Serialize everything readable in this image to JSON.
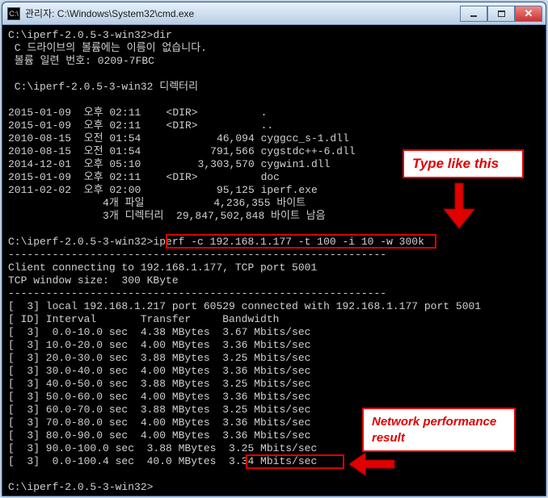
{
  "window": {
    "title": "관리자: C:\\Windows\\System32\\cmd.exe",
    "icon_glyph": "C:\\"
  },
  "terminal": {
    "prompt1": "C:\\iperf-2.0.5-3-win32>",
    "cmd_dir": "dir",
    "vol_line": " C 드라이브의 볼륨에는 이름이 없습니다.",
    "serial_line": " 볼륨 일련 번호: 0209-7FBC",
    "dir_header": " C:\\iperf-2.0.5-3-win32 디렉터리",
    "listing": [
      "2015-01-09  오후 02:11    <DIR>          .",
      "2015-01-09  오후 02:11    <DIR>          ..",
      "2010-08-15  오전 01:54            46,094 cyggcc_s-1.dll",
      "2010-08-15  오전 01:54           791,566 cygstdc++-6.dll",
      "2014-12-01  오후 05:10         3,303,570 cygwin1.dll",
      "2015-01-09  오후 02:11    <DIR>          doc",
      "2011-02-02  오후 02:00            95,125 iperf.exe",
      "               4개 파일           4,236,355 바이트",
      "               3개 디렉터리  29,847,502,848 바이트 남음"
    ],
    "prompt2": "C:\\iperf-2.0.5-3-win32>",
    "cmd_iperf": "iperf -c 192.168.1.177 -t 100 -i 10 -w 300k",
    "sep": "------------------------------------------------------------",
    "conn_line": "Client connecting to 192.168.1.177, TCP port 5001",
    "winsize_line": "TCP window size:  300 KByte",
    "local_line": "[  3] local 192.168.1.217 port 60529 connected with 192.168.1.177 port 5001",
    "header_line": "[ ID] Interval       Transfer     Bandwidth",
    "results": [
      "[  3]  0.0-10.0 sec  4.38 MBytes  3.67 Mbits/sec",
      "[  3] 10.0-20.0 sec  4.00 MBytes  3.36 Mbits/sec",
      "[  3] 20.0-30.0 sec  3.88 MBytes  3.25 Mbits/sec",
      "[  3] 30.0-40.0 sec  4.00 MBytes  3.36 Mbits/sec",
      "[  3] 40.0-50.0 sec  3.88 MBytes  3.25 Mbits/sec",
      "[  3] 50.0-60.0 sec  4.00 MBytes  3.36 Mbits/sec",
      "[  3] 60.0-70.0 sec  3.88 MBytes  3.25 Mbits/sec",
      "[  3] 70.0-80.0 sec  4.00 MBytes  3.36 Mbits/sec",
      "[  3] 80.0-90.0 sec  4.00 MBytes  3.36 Mbits/sec",
      "[  3] 90.0-100.0 sec  3.88 MBytes  3.25 Mbits/sec",
      "[  3]  0.0-100.4 sec  40.0 MBytes  3.34 Mbits/sec"
    ],
    "prompt3": "C:\\iperf-2.0.5-3-win32>"
  },
  "annotations": {
    "callout1": "Type like this",
    "callout2": "Network performance result"
  },
  "chart_data": {
    "type": "table",
    "title": "iperf bandwidth report",
    "columns": [
      "Interval (sec)",
      "Transfer (MBytes)",
      "Bandwidth (Mbits/sec)"
    ],
    "rows": [
      [
        "0.0-10.0",
        4.38,
        3.67
      ],
      [
        "10.0-20.0",
        4.0,
        3.36
      ],
      [
        "20.0-30.0",
        3.88,
        3.25
      ],
      [
        "30.0-40.0",
        4.0,
        3.36
      ],
      [
        "40.0-50.0",
        3.88,
        3.25
      ],
      [
        "50.0-60.0",
        4.0,
        3.36
      ],
      [
        "60.0-70.0",
        3.88,
        3.25
      ],
      [
        "70.0-80.0",
        4.0,
        3.36
      ],
      [
        "80.0-90.0",
        4.0,
        3.36
      ],
      [
        "90.0-100.0",
        3.88,
        3.25
      ],
      [
        "0.0-100.4",
        40.0,
        3.34
      ]
    ]
  }
}
